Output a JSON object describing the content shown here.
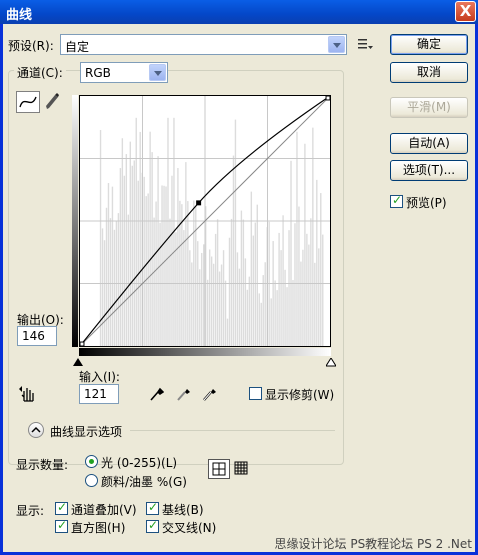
{
  "window": {
    "title": "曲线",
    "close_label": "X"
  },
  "preset": {
    "label": "预设(R):",
    "value": "自定"
  },
  "channel": {
    "label": "通道(C):",
    "value": "RGB"
  },
  "buttons": {
    "ok": "确定",
    "cancel": "取消",
    "smooth": "平滑(M)",
    "auto": "自动(A)",
    "options": "选项(T)..."
  },
  "preview": {
    "label": "预览(P)",
    "checked": true
  },
  "output": {
    "label": "输出(O):",
    "value": "146"
  },
  "input": {
    "label": "输入(I):",
    "value": "121"
  },
  "show_clipping": {
    "label": "显示修剪(W)",
    "checked": false
  },
  "curve_display": {
    "label": "曲线显示选项"
  },
  "show_amount": {
    "label": "显示数量:",
    "light": "光 (0-255)(L)",
    "pigment": "颜料/油墨 %(G)",
    "selected": "light"
  },
  "show": {
    "label": "显示:",
    "channel_overlay": "通道叠加(V)",
    "baseline": "基线(B)",
    "histogram": "直方图(H)",
    "intersection": "交叉线(N)"
  },
  "curve": {
    "points": [
      [
        0,
        0
      ],
      [
        121,
        146
      ],
      [
        255,
        255
      ]
    ]
  },
  "watermark": "思缘设计论坛  PS教程论坛 PS 2 .Net"
}
